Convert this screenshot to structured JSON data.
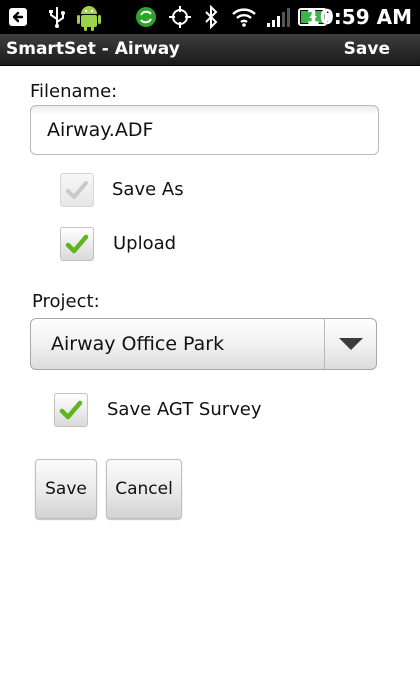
{
  "status_bar": {
    "time": "10:59",
    "time_suffix": "AM",
    "icons": [
      "back-arrow-icon",
      "usb-icon",
      "android-icon",
      "sync-icon",
      "gps-icon",
      "bluetooth-icon",
      "wifi-icon",
      "signal-icon",
      "battery-charging-icon"
    ]
  },
  "title_bar": {
    "title": "SmartSet - Airway",
    "action_label": "Save"
  },
  "form": {
    "filename_label": "Filename:",
    "filename_value": "Airway.ADF",
    "save_as_label": "Save As",
    "save_as_checked": true,
    "save_as_enabled": false,
    "upload_label": "Upload",
    "upload_checked": true,
    "project_label": "Project:",
    "project_selected": "Airway Office Park",
    "save_agt_label": "Save AGT Survey",
    "save_agt_checked": true,
    "save_button": "Save",
    "cancel_button": "Cancel"
  },
  "colors": {
    "check_green": "#5fb51f",
    "check_disabled": "#c9c9c9",
    "title_bar": "#2a2a2a",
    "status_bar": "#000000"
  }
}
